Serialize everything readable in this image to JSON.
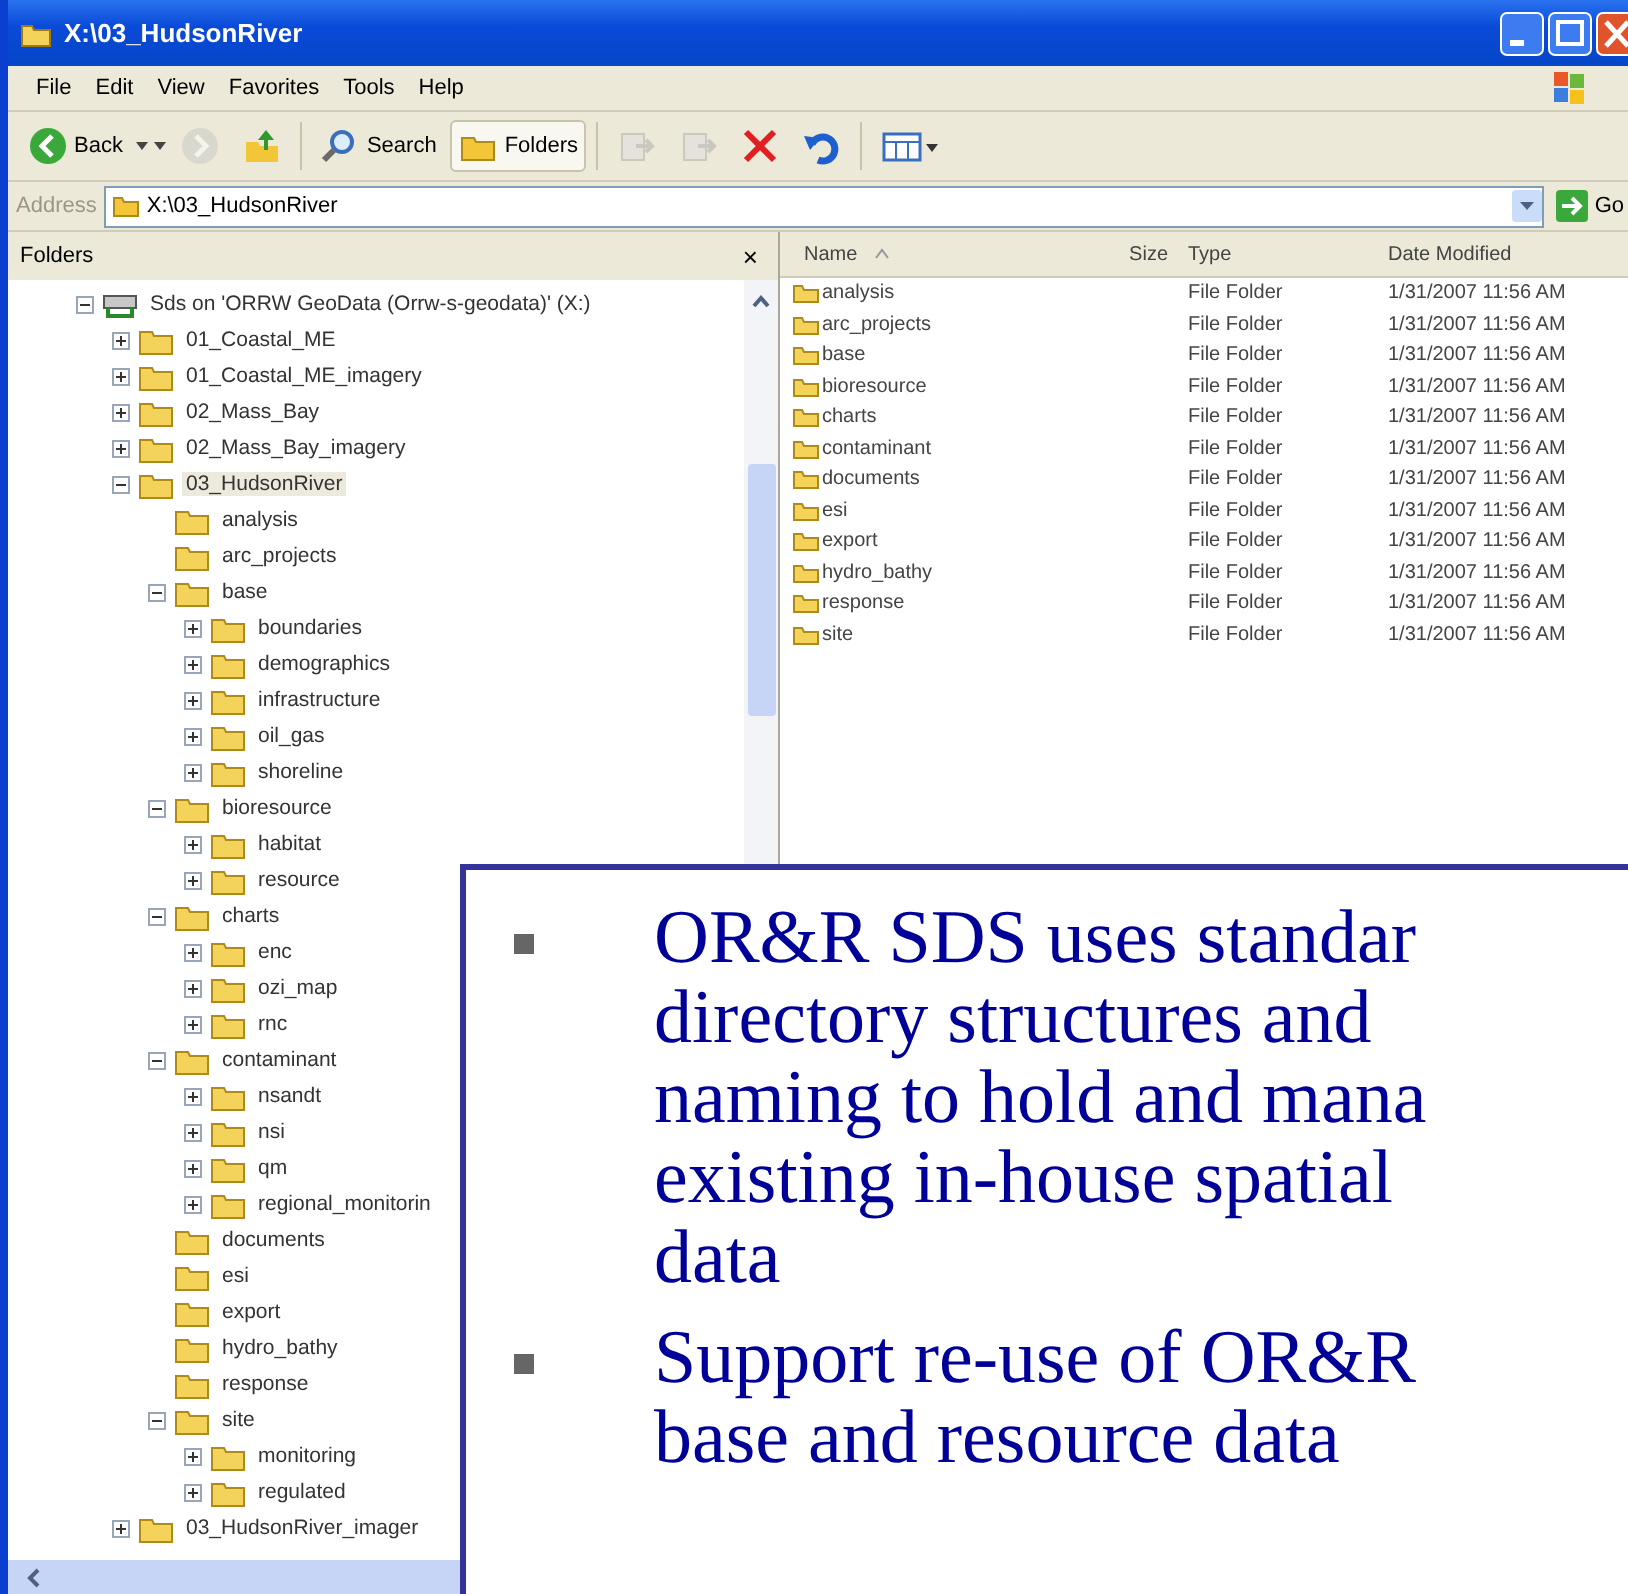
{
  "window": {
    "title": "X:\\03_HudsonRiver"
  },
  "menu": [
    "File",
    "Edit",
    "View",
    "Favorites",
    "Tools",
    "Help"
  ],
  "toolbar": [
    {
      "kind": "back",
      "label": "Back",
      "disabled": false
    },
    {
      "kind": "forward",
      "disabled": true
    },
    {
      "kind": "up",
      "disabled": false
    },
    {
      "kind": "search",
      "label": "Search",
      "disabled": false
    },
    {
      "kind": "folders",
      "label": "Folders",
      "disabled": false,
      "pressed": true
    },
    {
      "kind": "move",
      "disabled": true
    },
    {
      "kind": "copy",
      "disabled": true
    },
    {
      "kind": "delete",
      "disabled": false
    },
    {
      "kind": "undo",
      "disabled": false
    },
    {
      "kind": "views",
      "disabled": false
    }
  ],
  "address": {
    "label": "Address",
    "value": "X:\\03_HudsonRiver",
    "go": "Go"
  },
  "folders_pane": {
    "title": "Folders",
    "close": "×",
    "tree": [
      {
        "label": "Sds on 'ORRW GeoData (Orrw-s-geodata)' (X:)",
        "kind": "drive",
        "expanded": true,
        "selected": false,
        "children": [
          {
            "label": "01_Coastal_ME",
            "expanded": false,
            "selected": false
          },
          {
            "label": "01_Coastal_ME_imagery",
            "expanded": false,
            "selected": false
          },
          {
            "label": "02_Mass_Bay",
            "expanded": false,
            "selected": false
          },
          {
            "label": "02_Mass_Bay_imagery",
            "expanded": false,
            "selected": false
          },
          {
            "label": "03_HudsonRiver",
            "expanded": true,
            "selected": true,
            "children": [
              {
                "label": "analysis",
                "selected": false
              },
              {
                "label": "arc_projects",
                "selected": false
              },
              {
                "label": "base",
                "expanded": true,
                "selected": false,
                "children": [
                  {
                    "label": "boundaries",
                    "expanded": false,
                    "selected": false
                  },
                  {
                    "label": "demographics",
                    "expanded": false,
                    "selected": false
                  },
                  {
                    "label": "infrastructure",
                    "expanded": false,
                    "selected": false
                  },
                  {
                    "label": "oil_gas",
                    "expanded": false,
                    "selected": false
                  },
                  {
                    "label": "shoreline",
                    "expanded": false,
                    "selected": false
                  }
                ]
              },
              {
                "label": "bioresource",
                "expanded": true,
                "selected": false,
                "children": [
                  {
                    "label": "habitat",
                    "expanded": false,
                    "selected": false
                  },
                  {
                    "label": "resource",
                    "expanded": false,
                    "selected": false
                  }
                ]
              },
              {
                "label": "charts",
                "expanded": true,
                "selected": false,
                "children": [
                  {
                    "label": "enc",
                    "expanded": false,
                    "selected": false
                  },
                  {
                    "label": "ozi_map",
                    "expanded": false,
                    "selected": false
                  },
                  {
                    "label": "rnc",
                    "expanded": false,
                    "selected": false
                  }
                ]
              },
              {
                "label": "contaminant",
                "expanded": true,
                "selected": false,
                "children": [
                  {
                    "label": "nsandt",
                    "expanded": false,
                    "selected": false
                  },
                  {
                    "label": "nsi",
                    "expanded": false,
                    "selected": false
                  },
                  {
                    "label": "qm",
                    "expanded": false,
                    "selected": false
                  },
                  {
                    "label": "regional_monitorin",
                    "expanded": false,
                    "selected": false
                  }
                ]
              },
              {
                "label": "documents",
                "selected": false
              },
              {
                "label": "esi",
                "selected": false
              },
              {
                "label": "export",
                "selected": false
              },
              {
                "label": "hydro_bathy",
                "selected": false
              },
              {
                "label": "response",
                "selected": false
              },
              {
                "label": "site",
                "expanded": true,
                "selected": false,
                "children": [
                  {
                    "label": "monitoring",
                    "expanded": false,
                    "selected": false
                  },
                  {
                    "label": "regulated",
                    "expanded": false,
                    "selected": false
                  }
                ]
              }
            ]
          },
          {
            "label": "03_HudsonRiver_imager",
            "expanded": false,
            "selected": false
          }
        ]
      }
    ]
  },
  "file_list": {
    "columns": [
      "Name",
      "Size",
      "Type",
      "Date Modified"
    ],
    "rows": [
      {
        "name": "analysis",
        "type": "File Folder",
        "date": "1/31/2007 11:56 AM"
      },
      {
        "name": "arc_projects",
        "type": "File Folder",
        "date": "1/31/2007 11:56 AM"
      },
      {
        "name": "base",
        "type": "File Folder",
        "date": "1/31/2007 11:56 AM"
      },
      {
        "name": "bioresource",
        "type": "File Folder",
        "date": "1/31/2007 11:56 AM"
      },
      {
        "name": "charts",
        "type": "File Folder",
        "date": "1/31/2007 11:56 AM"
      },
      {
        "name": "contaminant",
        "type": "File Folder",
        "date": "1/31/2007 11:56 AM"
      },
      {
        "name": "documents",
        "type": "File Folder",
        "date": "1/31/2007 11:56 AM"
      },
      {
        "name": "esi",
        "type": "File Folder",
        "date": "1/31/2007 11:56 AM"
      },
      {
        "name": "export",
        "type": "File Folder",
        "date": "1/31/2007 11:56 AM"
      },
      {
        "name": "hydro_bathy",
        "type": "File Folder",
        "date": "1/31/2007 11:56 AM"
      },
      {
        "name": "response",
        "type": "File Folder",
        "date": "1/31/2007 11:56 AM"
      },
      {
        "name": "site",
        "type": "File Folder",
        "date": "1/31/2007 11:56 AM"
      }
    ]
  },
  "callout": {
    "bullets": [
      "OR&R SDS uses standar\ndirectory structures and\nnaming to hold and mana\nexisting in-house spatial\ndata",
      "Support re-use of OR&R\nbase and resource data"
    ]
  }
}
